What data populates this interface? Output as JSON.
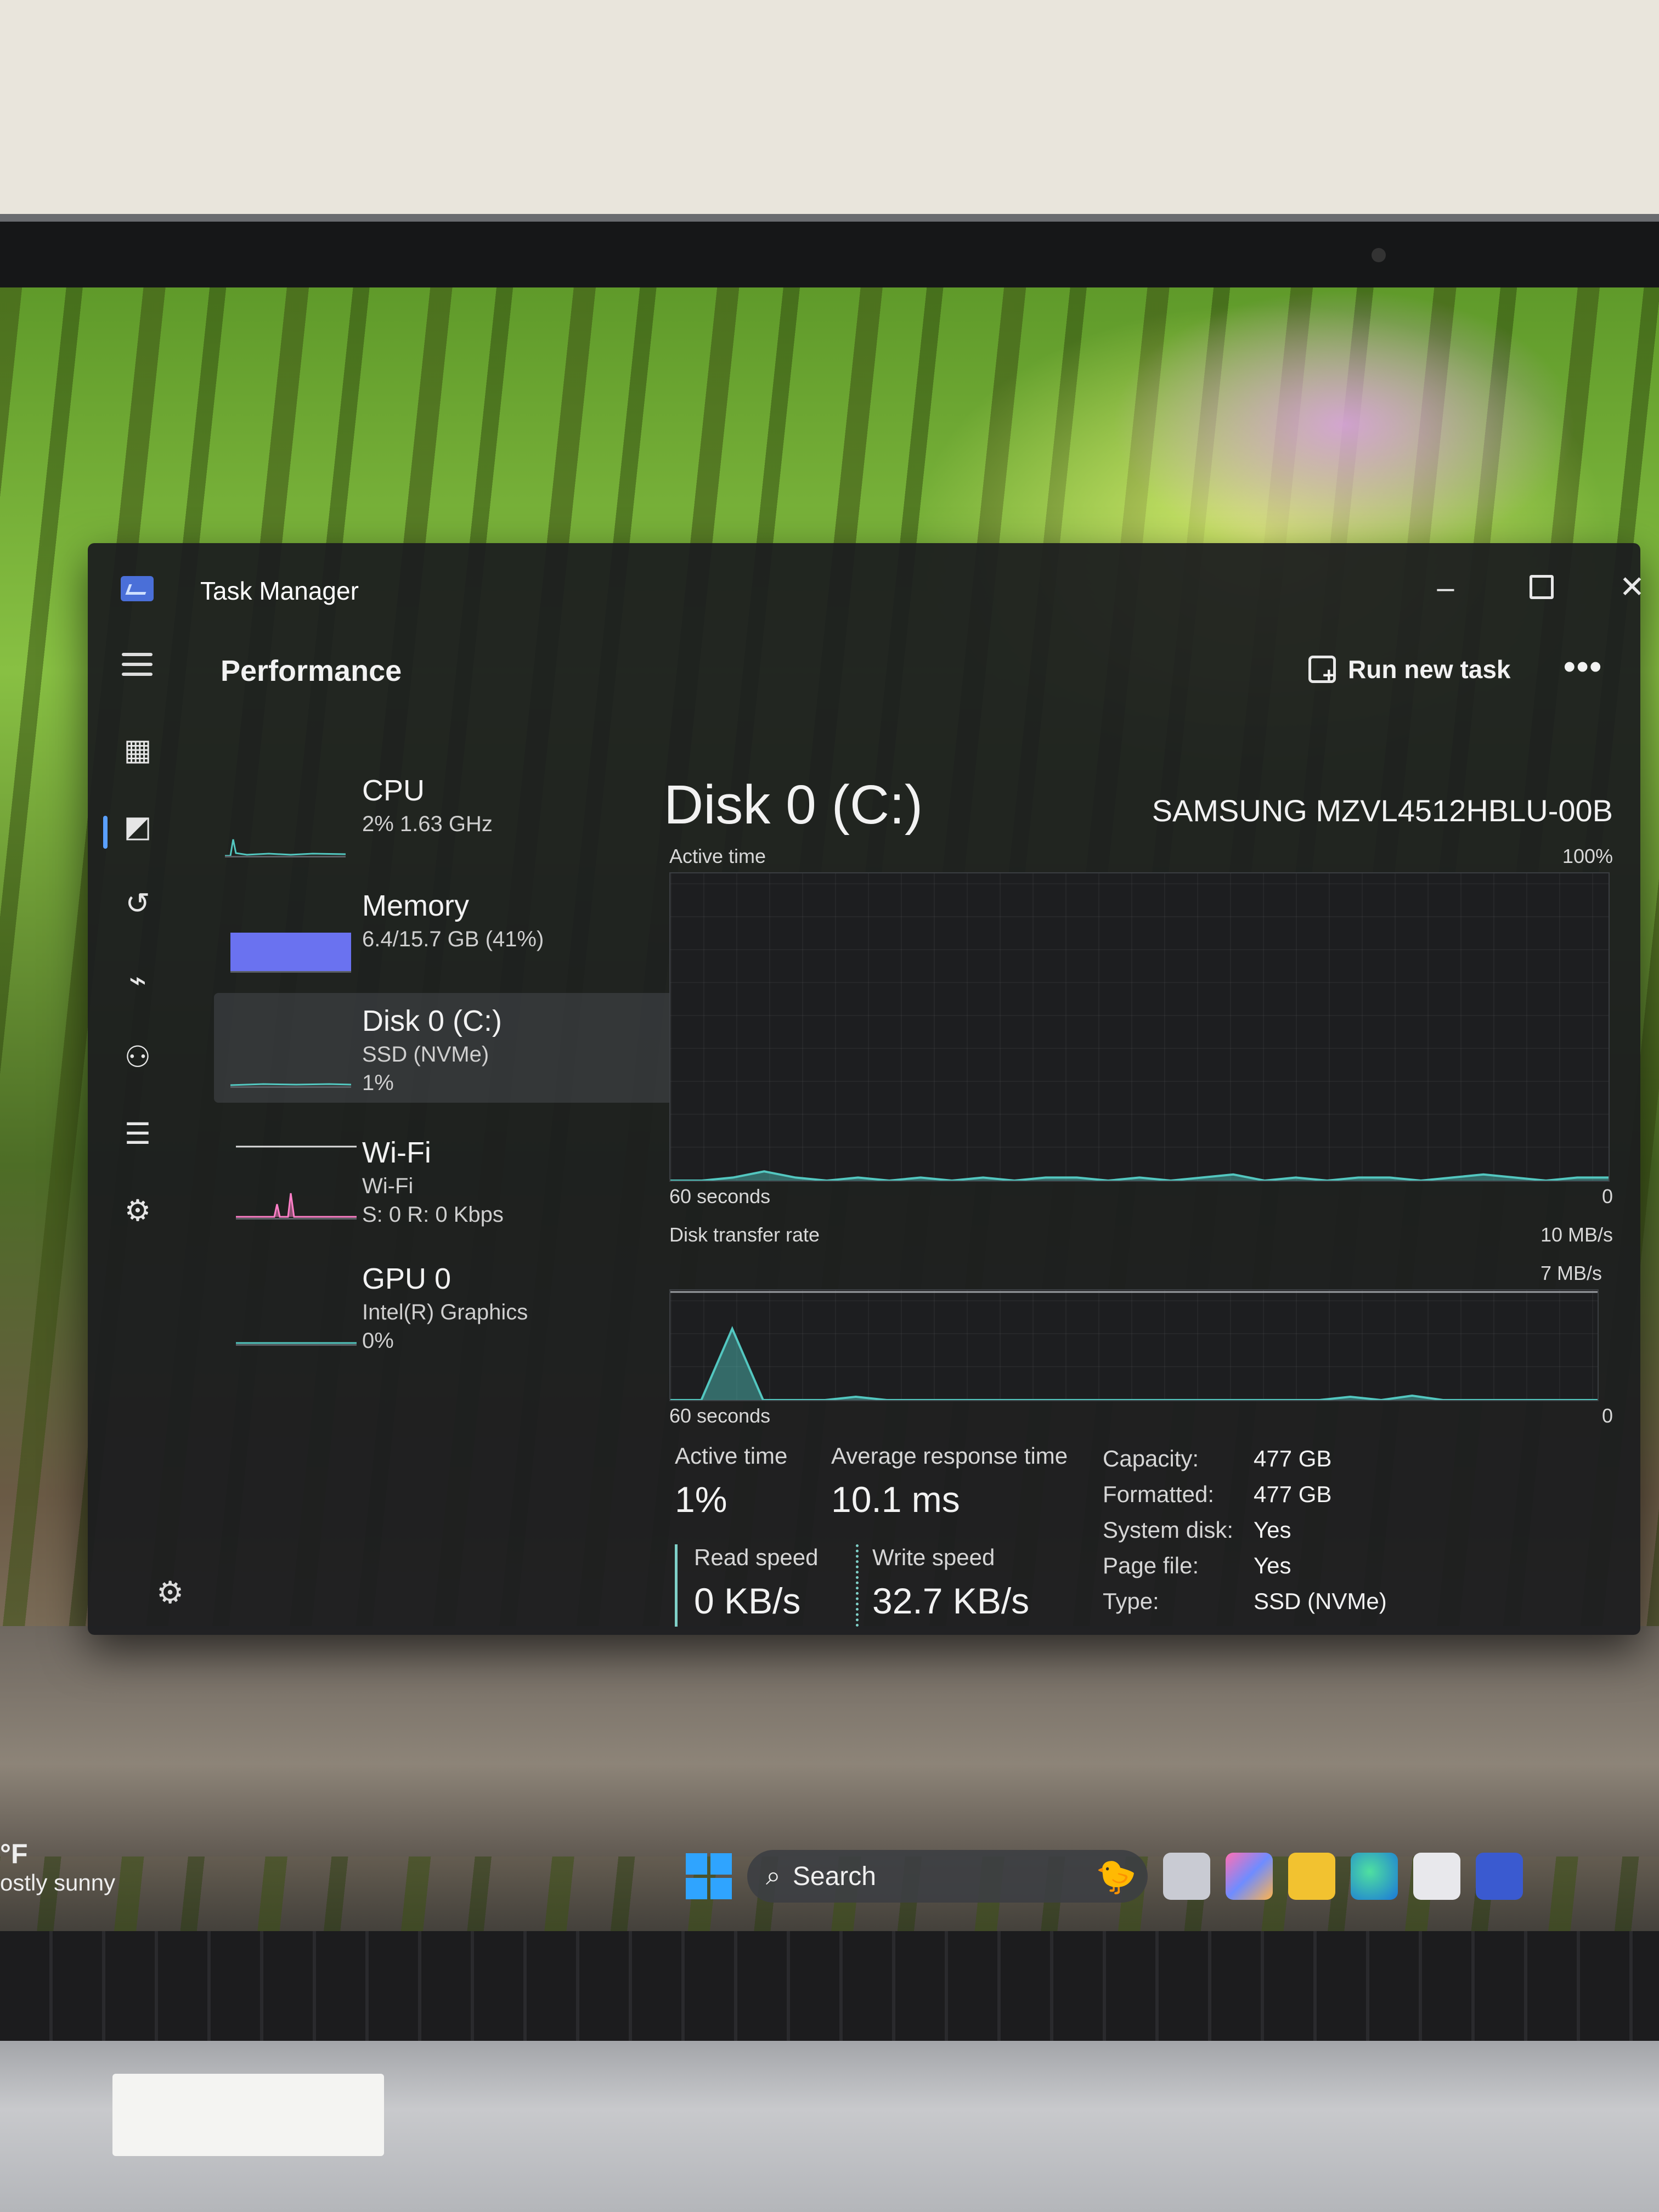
{
  "window": {
    "title": "Task Manager",
    "page_title": "Performance",
    "run_new_task": "Run new task",
    "more": "•••",
    "controls": {
      "minimize": "–",
      "close": "✕"
    }
  },
  "nav_icons": [
    "menu-icon",
    "processes-icon",
    "performance-icon",
    "app-history-icon",
    "startup-apps-icon",
    "users-icon",
    "details-icon",
    "services-icon",
    "settings-icon"
  ],
  "devices": [
    {
      "name": "CPU",
      "line1": "2% 1.63 GHz"
    },
    {
      "name": "Memory",
      "line1": "6.4/15.7 GB (41%)",
      "usage_fraction": 0.41
    },
    {
      "name": "Disk 0 (C:)",
      "line1": "SSD (NVMe)",
      "line2": "1%"
    },
    {
      "name": "Wi-Fi",
      "line1": "Wi-Fi",
      "line2": "S: 0 R: 0 Kbps"
    },
    {
      "name": "GPU 0",
      "line1": "Intel(R) Graphics",
      "line2": "0%"
    }
  ],
  "main": {
    "title": "Disk 0 (C:)",
    "model": "SAMSUNG MZVL4512HBLU-00B",
    "active_time_label": "Active time",
    "active_time_max": "100%",
    "sixty_seconds": "60 seconds",
    "zero": "0",
    "transfer_label": "Disk transfer rate",
    "transfer_max": "10 MB/s",
    "transfer_mid": "7 MB/s"
  },
  "chart_data": [
    {
      "type": "area",
      "title": "Active time",
      "ylim": [
        0,
        100
      ],
      "x_label": "60 seconds",
      "values": [
        0,
        0,
        1,
        3,
        1,
        0,
        1,
        0,
        1,
        0,
        1,
        0,
        1,
        1,
        0,
        1,
        0,
        1,
        2,
        0,
        1,
        0,
        1,
        1,
        0,
        1,
        2,
        1,
        0,
        1,
        1
      ]
    },
    {
      "type": "area",
      "title": "Disk transfer rate",
      "ylim": [
        0,
        10
      ],
      "x_label": "60 seconds",
      "values": [
        0,
        0,
        6.5,
        0,
        0,
        0,
        0.3,
        0,
        0,
        0,
        0,
        0,
        0,
        0,
        0,
        0,
        0,
        0,
        0,
        0,
        0,
        0,
        0.3,
        0,
        0.4,
        0,
        0,
        0,
        0,
        0,
        0
      ]
    }
  ],
  "stats": {
    "active_time": {
      "label": "Active time",
      "value": "1%"
    },
    "avg_response": {
      "label": "Average response time",
      "value": "10.1 ms"
    },
    "read_speed": {
      "label": "Read speed",
      "value": "0 KB/s"
    },
    "write_speed": {
      "label": "Write speed",
      "value": "32.7 KB/s"
    },
    "capacity": {
      "label": "Capacity:",
      "value": "477 GB"
    },
    "formatted": {
      "label": "Formatted:",
      "value": "477 GB"
    },
    "system_disk": {
      "label": "System disk:",
      "value": "Yes"
    },
    "page_file": {
      "label": "Page file:",
      "value": "Yes"
    },
    "type": {
      "label": "Type:",
      "value": "SSD (NVMe)"
    }
  },
  "taskbar": {
    "search_placeholder": "Search",
    "weather_temp": "°F",
    "weather_text": "ostly sunny"
  },
  "colors": {
    "memory_fill": "#6a72f0",
    "disk_line": "#53c7c0",
    "wifi_line": "#ff7fc8"
  }
}
